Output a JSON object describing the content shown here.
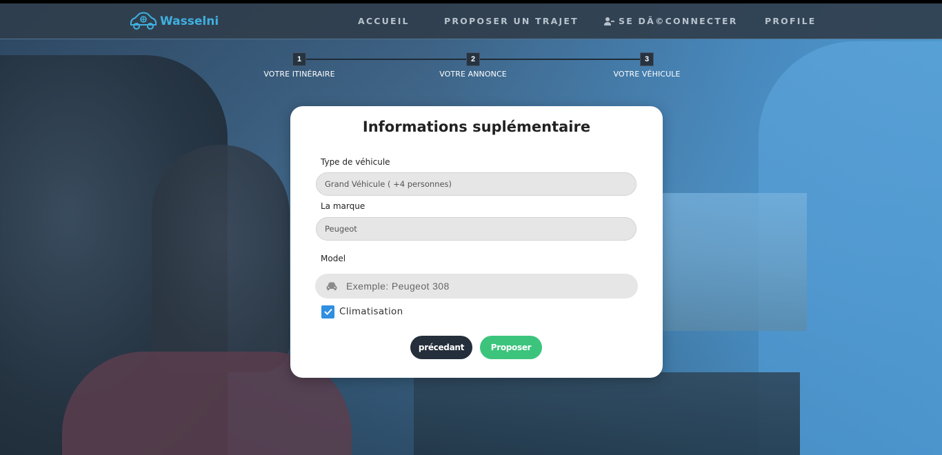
{
  "nav": {
    "brand": "Wasselni",
    "links": [
      {
        "label": "ACCUEIL"
      },
      {
        "label": "PROPOSER UN TRAJET"
      },
      {
        "label": "SE DÃ©CONNECTER"
      },
      {
        "label": "PROFILE"
      }
    ]
  },
  "stepper": {
    "steps": [
      {
        "number": "1",
        "label": "VOTRE ITINÉRAIRE"
      },
      {
        "number": "2",
        "label": "VOTRE ANNONCE"
      },
      {
        "number": "3",
        "label": "VOTRE VÉHICULE"
      }
    ]
  },
  "form": {
    "title": "Informations suplémentaire",
    "vehicle_type_label": "Type de véhicule",
    "vehicle_type_value": "Grand Véhicule ( +4 personnes)",
    "brand_label": "La marque",
    "brand_value": "Peugeot",
    "model_label": "Model",
    "model_placeholder": "Exemple: Peugeot 308",
    "ac_label": "Climatisation",
    "ac_checked": true,
    "prev_button": "précedant",
    "submit_button": "Proposer"
  },
  "colors": {
    "brand": "#3fb0e0",
    "submit": "#3cc47c",
    "prev": "#252e3b",
    "checkbox": "#2f8fe0"
  }
}
